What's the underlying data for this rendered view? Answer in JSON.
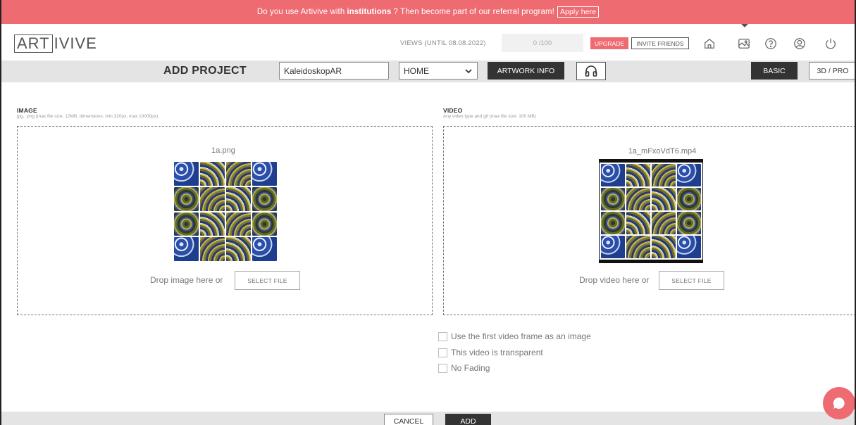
{
  "banner": {
    "text_before": "Do you use Artivive with",
    "text_bold": "institutions",
    "text_after": "? Then become part of our referral program!",
    "apply_label": "Apply here"
  },
  "header": {
    "logo_box": "ART",
    "logo_rest": "IVIVE",
    "views_label": "VIEWS (UNTIL 08.08.2022)",
    "views_count": "0 /100",
    "upgrade_label": "UPGRADE",
    "invite_label": "INVITE FRIENDS",
    "icons": [
      "home-icon",
      "artworks-icon",
      "help-icon",
      "account-icon",
      "logout-icon"
    ]
  },
  "toolbar": {
    "title": "ADD PROJECT",
    "project_name": "KaleidoskopAR",
    "category_selected": "HOME",
    "artwork_info_label": "ARTWORK INFO",
    "basic_label": "BASIC",
    "pro_label": "3D / PRO"
  },
  "image_section": {
    "title": "IMAGE",
    "hint": "jpg, .png (max file size: 12MB, dimensions: min 320px, max 10000px)",
    "file_name": "1a.png",
    "drop_label": "Drop image here or",
    "select_label": "SELECT FILE"
  },
  "video_section": {
    "title": "VIDEO",
    "hint": "Any video type and gif (max file size: 100 MB)",
    "file_name": "1a_mFxoVdT6.mp4",
    "drop_label": "Drop video here or",
    "select_label": "SELECT FILE"
  },
  "options": [
    {
      "label": "Use the first video frame as an image",
      "checked": false
    },
    {
      "label": "This video is transparent",
      "checked": false
    },
    {
      "label": "No Fading",
      "checked": false
    }
  ],
  "footer": {
    "cancel_label": "CANCEL",
    "add_label": "ADD"
  },
  "colors": {
    "accent": "#ee6b72",
    "dark": "#333333",
    "bar": "#e4e4e4"
  }
}
